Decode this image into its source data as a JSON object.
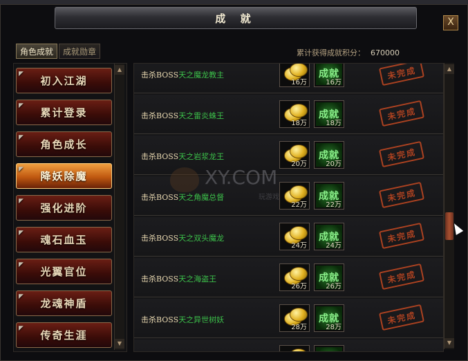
{
  "window": {
    "title": "成 就",
    "close_label": "X"
  },
  "tabs": [
    {
      "label": "角色成就",
      "active": true
    },
    {
      "label": "成就勋章",
      "active": false
    }
  ],
  "score": {
    "label": "累计获得成就积分：",
    "value": "670000"
  },
  "sidebar": {
    "items": [
      {
        "label": "初入江湖",
        "active": false
      },
      {
        "label": "累计登录",
        "active": false
      },
      {
        "label": "角色成长",
        "active": false
      },
      {
        "label": "降妖除魔",
        "active": true
      },
      {
        "label": "强化进阶",
        "active": false
      },
      {
        "label": "魂石血玉",
        "active": false
      },
      {
        "label": "光翼官位",
        "active": false
      },
      {
        "label": "龙魂神盾",
        "active": false
      },
      {
        "label": "传奇生涯",
        "active": false
      }
    ]
  },
  "achievements": [
    {
      "prefix": "击杀BOSS",
      "boss": "天之魔龙教主",
      "coin_reward": "16万",
      "achv_reward": "16万",
      "achv_label": "成就",
      "status": "未完成"
    },
    {
      "prefix": "击杀BOSS",
      "boss": "天之雷炎蛛王",
      "coin_reward": "18万",
      "achv_reward": "18万",
      "achv_label": "成就",
      "status": "未完成"
    },
    {
      "prefix": "击杀BOSS",
      "boss": "天之岩浆龙王",
      "coin_reward": "20万",
      "achv_reward": "20万",
      "achv_label": "成就",
      "status": "未完成"
    },
    {
      "prefix": "击杀BOSS",
      "boss": "天之角魔总督",
      "coin_reward": "22万",
      "achv_reward": "22万",
      "achv_label": "成就",
      "status": "未完成"
    },
    {
      "prefix": "击杀BOSS",
      "boss": "天之双头魔龙",
      "coin_reward": "24万",
      "achv_reward": "24万",
      "achv_label": "成就",
      "status": "未完成"
    },
    {
      "prefix": "击杀BOSS",
      "boss": "天之海盗王",
      "coin_reward": "26万",
      "achv_reward": "26万",
      "achv_label": "成就",
      "status": "未完成"
    },
    {
      "prefix": "击杀BOSS",
      "boss": "天之异世树妖",
      "coin_reward": "28万",
      "achv_reward": "28万",
      "achv_label": "成就",
      "status": "未完成"
    }
  ],
  "watermark": {
    "text": "XY.COM",
    "sub": "玩游戏"
  },
  "colors": {
    "boss_name": "#3cc04a",
    "stamp": "#c84a22",
    "active_side": "#e07a20"
  }
}
